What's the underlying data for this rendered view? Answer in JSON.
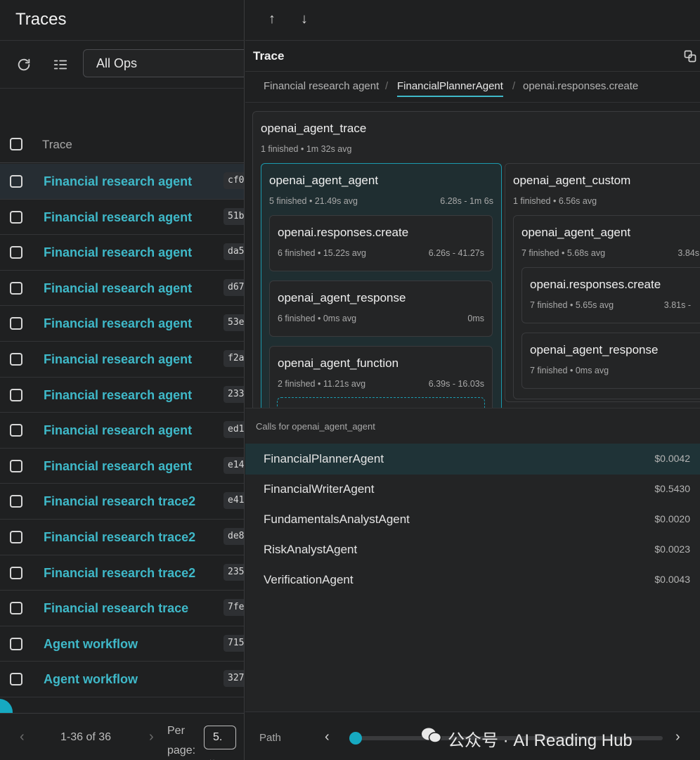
{
  "left": {
    "title": "Traces",
    "ops_select": "All Ops",
    "column_header": "Trace",
    "rows": [
      {
        "name": "Financial research agent",
        "id": "cf0",
        "selected": true
      },
      {
        "name": "Financial research agent",
        "id": "51b"
      },
      {
        "name": "Financial research agent",
        "id": "da5"
      },
      {
        "name": "Financial research agent",
        "id": "d67"
      },
      {
        "name": "Financial research agent",
        "id": "53e"
      },
      {
        "name": "Financial research agent",
        "id": "f2a"
      },
      {
        "name": "Financial research agent",
        "id": "233"
      },
      {
        "name": "Financial research agent",
        "id": "ed1"
      },
      {
        "name": "Financial research agent",
        "id": "e14"
      },
      {
        "name": "Financial research trace2",
        "id": "e41"
      },
      {
        "name": "Financial research trace2",
        "id": "de8"
      },
      {
        "name": "Financial research trace2",
        "id": "235"
      },
      {
        "name": "Financial research trace",
        "id": "7fe"
      },
      {
        "name": "Agent workflow",
        "id": "715"
      },
      {
        "name": "Agent workflow",
        "id": "327"
      }
    ],
    "pager": {
      "count": "1-36 of 36",
      "per_page_label": "Per page:",
      "per_page_value": "5."
    }
  },
  "right": {
    "trace_title": "Trace",
    "breadcrumbs": [
      "Financial research agent",
      "FinancialPlannerAgent",
      "openai.responses.create"
    ],
    "nodes": {
      "root": {
        "title": "openai_agent_trace",
        "sub": "1 finished • 1m 32s avg"
      },
      "agent": {
        "title": "openai_agent_agent",
        "sub": "5 finished • 21.49s avg",
        "range": "6.28s - 1m 6s"
      },
      "resp_create": {
        "title": "openai.responses.create",
        "sub": "6 finished • 15.22s avg",
        "range": "6.26s - 41.27s"
      },
      "agent_response": {
        "title": "openai_agent_response",
        "sub": "6 finished • 0ms avg",
        "range": "0ms"
      },
      "agent_function": {
        "title": "openai_agent_function",
        "sub": "2 finished • 11.21s avg",
        "range": "6.39s - 16.03s"
      },
      "custom": {
        "title": "openai_agent_custom",
        "sub": "1 finished • 6.56s avg"
      },
      "custom_agent": {
        "title": "openai_agent_agent",
        "sub": "7 finished • 5.68s avg",
        "range": "3.84s"
      },
      "custom_resp_create": {
        "title": "openai.responses.create",
        "sub": "7 finished • 5.65s avg",
        "range": "3.81s - "
      },
      "custom_agent_response": {
        "title": "openai_agent_response",
        "sub": "7 finished • 0ms avg"
      }
    },
    "calls_title": "Calls for openai_agent_agent",
    "calls": [
      {
        "name": "FinancialPlannerAgent",
        "cost": "$0.0042",
        "selected": true
      },
      {
        "name": "FinancialWriterAgent",
        "cost": "$0.5430"
      },
      {
        "name": "FundamentalsAnalystAgent",
        "cost": "$0.0020"
      },
      {
        "name": "RiskAnalystAgent",
        "cost": "$0.0023"
      },
      {
        "name": "VerificationAgent",
        "cost": "$0.0043"
      }
    ],
    "path_label": "Path",
    "watermark": "公众号 · AI Reading Hub"
  },
  "colors": {
    "accent": "#3fb9c9",
    "accent_border": "#1b9aae",
    "background": "#1f2021"
  }
}
